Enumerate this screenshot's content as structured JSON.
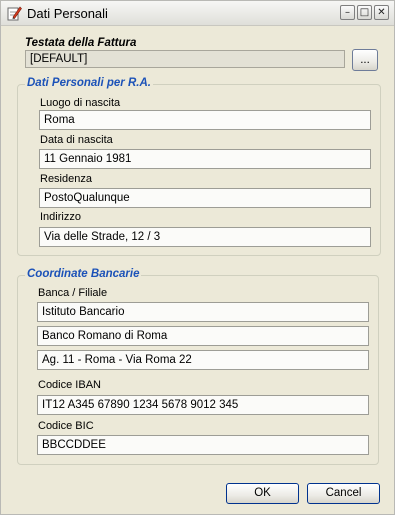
{
  "window": {
    "title": "Dati Personali",
    "icons": {
      "app": "pencil-note-icon",
      "minimize": "minimize-icon",
      "maximize": "maximize-icon",
      "close": "close-icon"
    },
    "glyphs": {
      "minimize": "–",
      "maximize": "□",
      "close": "✕"
    }
  },
  "invoice_header": {
    "label": "Testata della Fattura",
    "value": "[DEFAULT]",
    "browse_label": "..."
  },
  "personal_data": {
    "legend": "Dati Personali per R.A.",
    "birthplace_label": "Luogo di nascita",
    "birthplace_value": "Roma",
    "birthdate_label": "Data di nascita",
    "birthdate_value": "11 Gennaio 1981",
    "residence_label": "Residenza",
    "residence_value": "PostoQualunque",
    "address_label": "Indirizzo",
    "address_value": "Via delle Strade, 12 / 3"
  },
  "bank": {
    "legend": "Coordinate Bancarie",
    "bank_branch_label": "Banca / Filiale",
    "bank_line1": "Istituto Bancario",
    "bank_line2": "Banco Romano di Roma",
    "bank_line3": "Ag. 11 - Roma - Via Roma 22",
    "iban_label": "Codice IBAN",
    "iban_value": "IT12 A345 67890 1234 5678 9012 345",
    "bic_label": "Codice BIC",
    "bic_value": "BBCCDDEE"
  },
  "buttons": {
    "ok": "OK",
    "cancel": "Cancel"
  },
  "colors": {
    "legend_blue": "#1c52b8",
    "dialog_bg": "#ece9d8",
    "button_border": "#00328e"
  }
}
